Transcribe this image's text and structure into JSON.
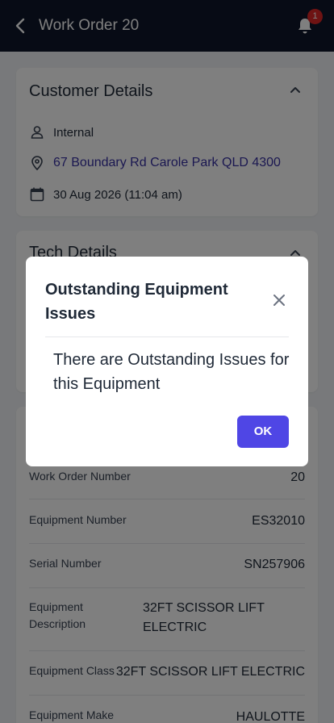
{
  "header": {
    "title": "Work Order 20",
    "notification_count": "1"
  },
  "customer": {
    "title": "Customer Details",
    "type": "Internal",
    "address": "67 Boundary Rd Carole Park QLD 4300",
    "datetime": "30 Aug 2026 (11:04 am)"
  },
  "tech": {
    "title": "Tech Details"
  },
  "equipment": {
    "rows": [
      {
        "label": "Work Order Number",
        "value": "20"
      },
      {
        "label": "Equipment Number",
        "value": "ES32010"
      },
      {
        "label": "Serial Number",
        "value": "SN257906"
      },
      {
        "label": "Equipment Description",
        "value": "32FT SCISSOR LIFT ELECTRIC"
      },
      {
        "label": "Equipment Class",
        "value": "32FT SCISSOR LIFT ELECTRIC"
      },
      {
        "label": "Equipment Make",
        "value": "HAULOTTE"
      }
    ]
  },
  "modal": {
    "title": "Outstanding Equipment Issues",
    "message": "There are Outstanding Issues for this Equipment",
    "ok_label": "OK"
  },
  "colors": {
    "header_bg": "#0f172a",
    "accent": "#4f46e5",
    "link": "#3730a3",
    "badge": "#dc2626"
  }
}
